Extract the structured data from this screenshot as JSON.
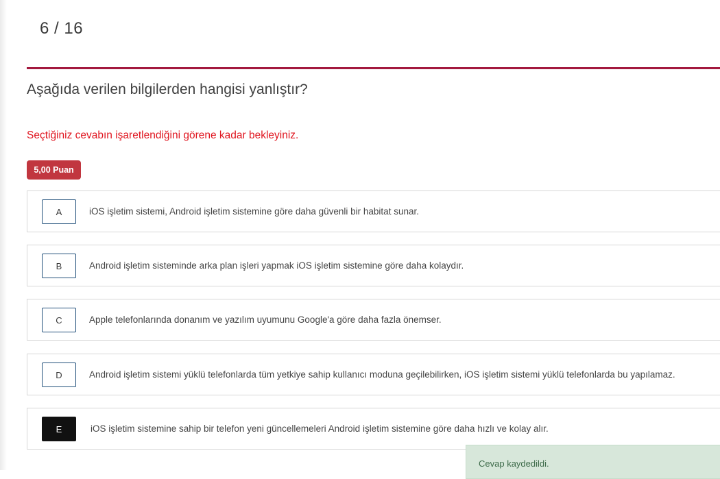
{
  "question_counter": "6 / 16",
  "question": {
    "text": "Aşağıda verilen bilgilerden hangisi yanlıştır?",
    "warning": "Seçtiğiniz cevabın işaretlendiğini görene kadar bekleyiniz.",
    "points": "5,00 Puan"
  },
  "options": [
    {
      "letter": "A",
      "text": "iOS işletim sistemi, Android işletim sistemine göre daha güvenli bir habitat sunar."
    },
    {
      "letter": "B",
      "text": "Android işletim sisteminde arka plan işleri yapmak iOS işletim sistemine göre daha kolaydır."
    },
    {
      "letter": "C",
      "text": "Apple telefonlarında donanım ve yazılım uyumunu Google'a göre daha fazla önemser."
    },
    {
      "letter": "D",
      "text": "Android işletim sistemi yüklü telefonlarda tüm yetkiye sahip kullanıcı moduna geçilebilirken, iOS işletim sistemi yüklü telefonlarda bu yapılamaz."
    },
    {
      "letter": "E",
      "text": "iOS işletim sistemine sahip bir telefon yeni güncellemeleri Android işletim sistemine göre daha hızlı ve kolay alır."
    }
  ],
  "selected_option": "E",
  "toast": {
    "text": "Cevap kaydedildi."
  },
  "colors": {
    "accent_divider": "#a3193e",
    "warning_text": "#e0141e",
    "points_badge": "#c1363f",
    "selected_letter_bg": "#111111",
    "toast_bg": "#d7e7da"
  }
}
